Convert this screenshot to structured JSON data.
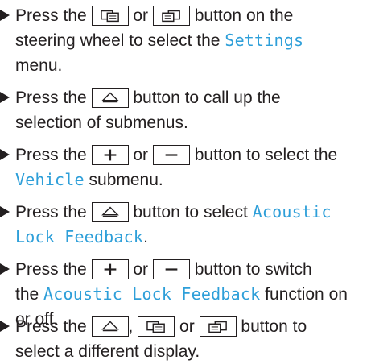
{
  "colors": {
    "text": "#231f20",
    "highlight": "#2e9fd9"
  },
  "steps": [
    {
      "l1_a": "Press the ",
      "l1_b": " or ",
      "l1_c": " button on the",
      "l2_a": "steering wheel to select the ",
      "l2_hl": "Settings",
      "l3_a": "menu."
    },
    {
      "l1_a": "Press the ",
      "l1_b": " button to call up the",
      "l2_a": "selection of submenus."
    },
    {
      "l1_a": "Press the ",
      "l1_b": " or ",
      "l1_c": " button to select the",
      "l2_hl": "Vehicle",
      "l2_a": " submenu."
    },
    {
      "l1_a": "Press the ",
      "l1_b": " button to select ",
      "l1_hl": "Acoustic",
      "l2_hl": "Lock Feedback",
      "l2_a": "."
    },
    {
      "l1_a": "Press the ",
      "l1_b": " or ",
      "l1_c": " button to switch",
      "l2_a": "the ",
      "l2_hl": "Acoustic Lock Feedback",
      "l2_b": " function on",
      "l3_a": "or off."
    },
    {
      "l1_a": "Press the ",
      "l1_b": ", ",
      "l1_c": " or ",
      "l1_d": " button to",
      "l2_a": "select a different display."
    }
  ],
  "icons": {
    "bullet": "right-triangle-bullet",
    "page_back": "page-back-icon",
    "page_forward": "page-forward-icon",
    "back": "back-arrow-up-icon",
    "plus": "plus-icon",
    "minus": "minus-icon"
  }
}
